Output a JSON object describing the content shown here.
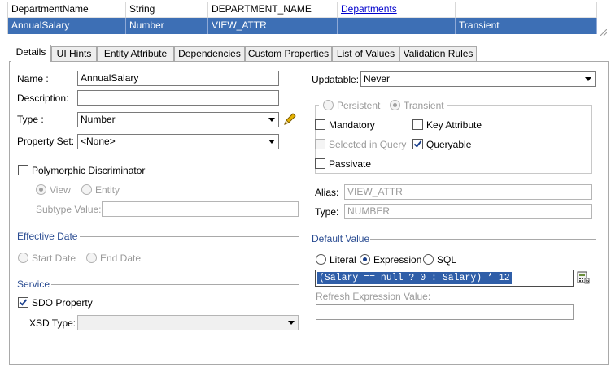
{
  "grid": {
    "rows": [
      {
        "name": "DepartmentName",
        "type": "String",
        "column": "DEPARTMENT_NAME",
        "entity": "Departments",
        "kind": ""
      },
      {
        "name": "AnnualSalary",
        "type": "Number",
        "column": "VIEW_ATTR",
        "entity": "",
        "kind": "Transient"
      }
    ]
  },
  "tabs": [
    "Details",
    "UI Hints",
    "Entity Attribute",
    "Dependencies",
    "Custom Properties",
    "List of Values",
    "Validation Rules"
  ],
  "left": {
    "name_label": "Name :",
    "name_value": "AnnualSalary",
    "description_label": "Description:",
    "description_value": "",
    "type_label": "Type :",
    "type_value": "Number",
    "property_set_label": "Property Set:",
    "property_set_value": "<None>",
    "polymorphic_label": "Polymorphic Discriminator",
    "view_label": "View",
    "entity_label": "Entity",
    "subtype_label": "Subtype Value:",
    "effective_date_label": "Effective Date",
    "start_date_label": "Start Date",
    "end_date_label": "End Date",
    "service_label": "Service",
    "sdo_label": "SDO Property",
    "xsd_type_label": "XSD Type:",
    "xsd_type_value": ""
  },
  "right": {
    "updatable_label": "Updatable:",
    "updatable_value": "Never",
    "persistent_label": "Persistent",
    "transient_label": "Transient",
    "mandatory_label": "Mandatory",
    "key_attribute_label": "Key Attribute",
    "selected_in_query_label": "Selected in Query",
    "queryable_label": "Queryable",
    "passivate_label": "Passivate",
    "alias_label": "Alias:",
    "alias_value": "VIEW_ATTR",
    "type_label": "Type:",
    "type_value": "NUMBER",
    "default_value_label": "Default Value",
    "literal_label": "Literal",
    "expression_label": "Expression",
    "sql_label": "SQL",
    "expression_value": "(Salary == null ? 0 : Salary) * 12",
    "refresh_label": "Refresh Expression Value:",
    "refresh_value": ""
  },
  "colors": {
    "selection": "#3d6fb5",
    "section_header": "#2a4c92",
    "link": "#0000cc"
  }
}
